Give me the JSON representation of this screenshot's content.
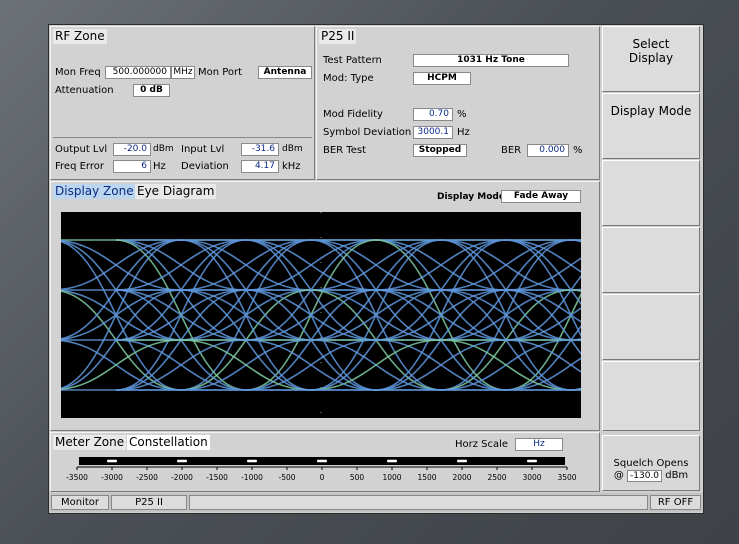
{
  "rf_zone": {
    "title": "RF Zone",
    "mon_freq_label": "Mon Freq",
    "mon_freq_value": "500.000000",
    "mon_freq_unit": "MHz",
    "mon_port_label": "Mon Port",
    "mon_port_value": "Antenna",
    "attenuation_label": "Attenuation",
    "attenuation_value": "0 dB",
    "output_lvl_label": "Output Lvl",
    "output_lvl_value": "-20.0",
    "output_lvl_unit": "dBm",
    "input_lvl_label": "Input Lvl",
    "input_lvl_value": "-31.6",
    "input_lvl_unit": "dBm",
    "freq_error_label": "Freq Error",
    "freq_error_value": "6",
    "freq_error_unit": "Hz",
    "deviation_label": "Deviation",
    "deviation_value": "4.17",
    "deviation_unit": "kHz"
  },
  "p25": {
    "title": "P25 II",
    "test_pattern_label": "Test Pattern",
    "test_pattern_value": "1031 Hz Tone",
    "mod_type_label": "Mod: Type",
    "mod_type_value": "HCPM",
    "mod_fidelity_label": "Mod Fidelity",
    "mod_fidelity_value": "0.70",
    "mod_fidelity_unit": "%",
    "symbol_deviation_label": "Symbol Deviation",
    "symbol_deviation_value": "3000.1",
    "symbol_deviation_unit": "Hz",
    "ber_test_label": "BER Test",
    "ber_test_value": "Stopped",
    "ber_label": "BER",
    "ber_value": "0.000",
    "ber_unit": "%"
  },
  "display_zone": {
    "title_hot": "Display Zone",
    "title": "Eye Diagram",
    "display_mode_label": "Display Mode",
    "display_mode_value": "Fade Away"
  },
  "meter_zone": {
    "title_hot": "Meter Zone",
    "title": "Constellation",
    "horz_scale_label": "Horz Scale",
    "horz_scale_value": "Hz",
    "ticks": [
      "-3500",
      "-3000",
      "-2500",
      "-2000",
      "-1500",
      "-1000",
      "-500",
      "0",
      "500",
      "1000",
      "1500",
      "2000",
      "2500",
      "3000",
      "3500"
    ]
  },
  "softkeys": {
    "select_display": "Select Display",
    "display_mode": "Display Mode",
    "squelch_label": "Squelch Opens",
    "squelch_at": "@",
    "squelch_value": "-130.0",
    "squelch_unit": "dBm"
  },
  "status": {
    "monitor": "Monitor",
    "mode": "P25 II",
    "rf": "RF OFF"
  },
  "colors": {
    "trace": "#5e96dc",
    "trace_green": "#7ec9a0",
    "background": "#000000"
  }
}
